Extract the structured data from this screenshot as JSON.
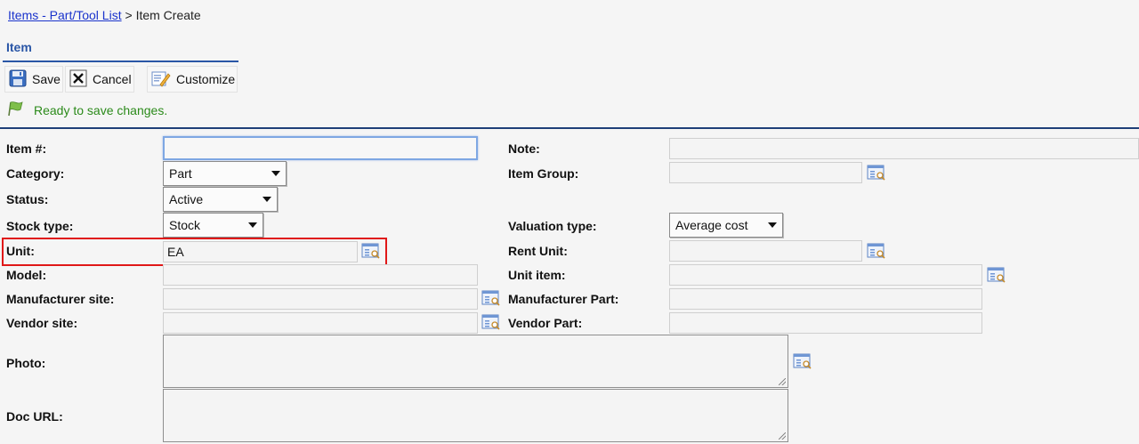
{
  "breadcrumb": {
    "link": "Items - Part/Tool List",
    "separator": ">",
    "current": "Item Create"
  },
  "section_title": "Item",
  "toolbar": {
    "save_label": "Save",
    "cancel_label": "Cancel",
    "customize_label": "Customize"
  },
  "status_message": "Ready to save changes.",
  "form": {
    "item_no": {
      "label": "Item #:",
      "value": ""
    },
    "category": {
      "label": "Category:",
      "value": "Part"
    },
    "status": {
      "label": "Status:",
      "value": "Active"
    },
    "stock_type": {
      "label": "Stock type:",
      "value": "Stock"
    },
    "unit": {
      "label": "Unit:",
      "value": "EA"
    },
    "model": {
      "label": "Model:",
      "value": ""
    },
    "manufacturer_site": {
      "label": "Manufacturer site:",
      "value": ""
    },
    "vendor_site": {
      "label": "Vendor site:",
      "value": ""
    },
    "photo": {
      "label": "Photo:"
    },
    "doc_url": {
      "label": "Doc URL:"
    },
    "note": {
      "label": "Note:",
      "value": ""
    },
    "item_group": {
      "label": "Item Group:",
      "value": ""
    },
    "valuation_type": {
      "label": "Valuation type:",
      "value": "Average cost"
    },
    "rent_unit": {
      "label": "Rent Unit:",
      "value": ""
    },
    "unit_item": {
      "label": "Unit item:",
      "value": ""
    },
    "manufacturer_part": {
      "label": "Manufacturer Part:",
      "value": ""
    },
    "vendor_part": {
      "label": "Vendor Part:",
      "value": ""
    }
  },
  "colors": {
    "accent": "#2a56a6",
    "rule": "#1f3f78",
    "status": "#2b8a1a",
    "highlight": "#e01818"
  },
  "icons": {
    "save": "floppy-disk-icon",
    "cancel": "close-icon",
    "customize": "customize-icon",
    "status": "flag-icon",
    "lookup": "lookup-icon"
  }
}
